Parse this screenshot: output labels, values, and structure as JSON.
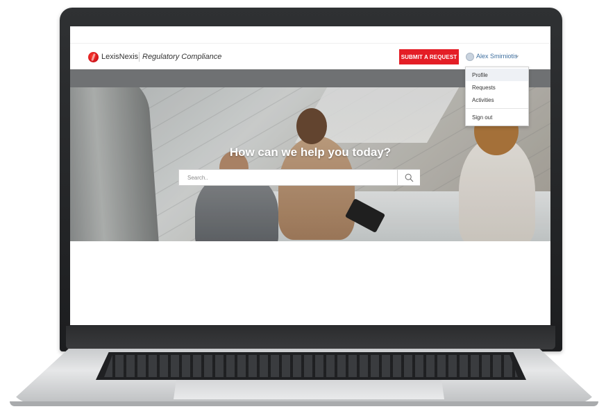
{
  "header": {
    "brand": "LexisNexis",
    "product": "Regulatory Compliance",
    "submit_label": "SUBMIT A REQUEST",
    "user_name": "Alex Smirniotis",
    "user_chevron": "⌄"
  },
  "user_menu": {
    "items": [
      {
        "label": "Profile"
      },
      {
        "label": "Requests"
      },
      {
        "label": "Activities"
      },
      {
        "label": "Sign out"
      }
    ]
  },
  "hero": {
    "title": "How can we help you today?",
    "search_placeholder": "Search..",
    "search_icon": "search-icon"
  },
  "colors": {
    "accent": "#e41e26",
    "link": "#3d6e9e",
    "band": "#6f7173"
  }
}
